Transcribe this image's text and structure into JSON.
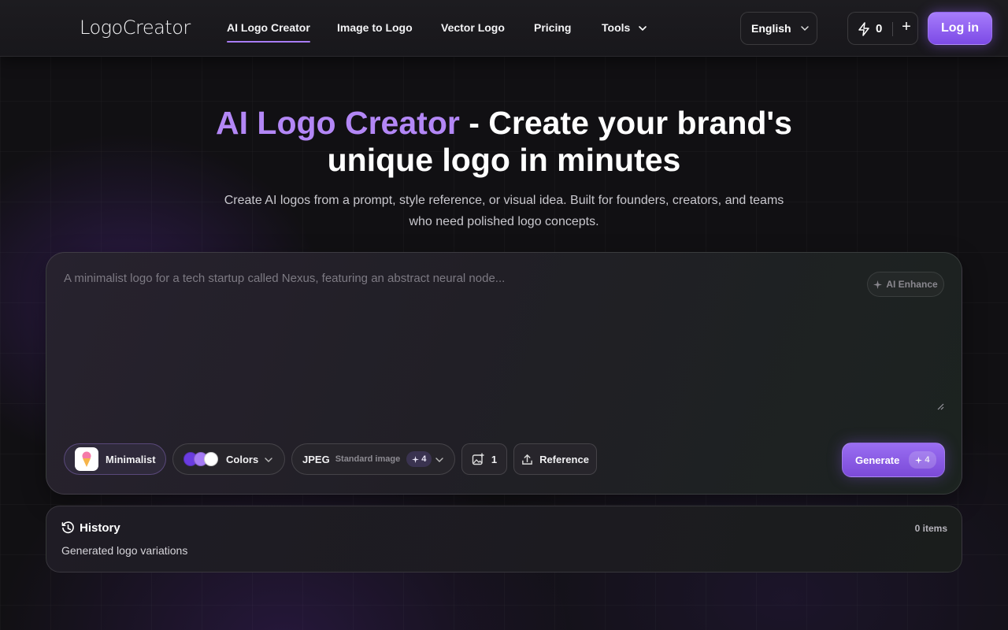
{
  "header": {
    "logo": "LogoCreator",
    "nav": [
      {
        "label": "AI Logo Creator",
        "active": true
      },
      {
        "label": "Image to Logo"
      },
      {
        "label": "Vector Logo"
      },
      {
        "label": "Pricing"
      },
      {
        "label": "Tools",
        "has_dropdown": true
      }
    ],
    "language": "English",
    "credits": "0",
    "plus": "+",
    "login_label": "Log in"
  },
  "hero": {
    "title_accent": "AI Logo Creator",
    "title_rest_line1": " - Create your brand's",
    "title_line2": "unique logo in minutes",
    "subtitle_line1": "Create AI logos from a prompt, style reference, or visual idea. Built for founders, creators, and teams",
    "subtitle_line2": "who need polished logo concepts."
  },
  "prompt": {
    "placeholder": "A minimalist logo for a tech startup called Nexus, featuring an abstract neural node...",
    "ai_enhance": "AI Enhance",
    "style_label": "Minimalist",
    "colors_label": "Colors",
    "color_dots": [
      "#6a3ce0",
      "#a57bf5",
      "#ffffff"
    ],
    "format_label": "JPEG",
    "format_sub": "Standard image",
    "format_cost": "4",
    "count": "1",
    "reference_label": "Reference",
    "generate_label": "Generate",
    "generate_cost": "4"
  },
  "history": {
    "title": "History",
    "subtitle": "Generated logo variations",
    "count": "0 items"
  },
  "colors": {
    "accent": "#b387f6",
    "button": "#8b5cf6",
    "background": "#111013"
  }
}
